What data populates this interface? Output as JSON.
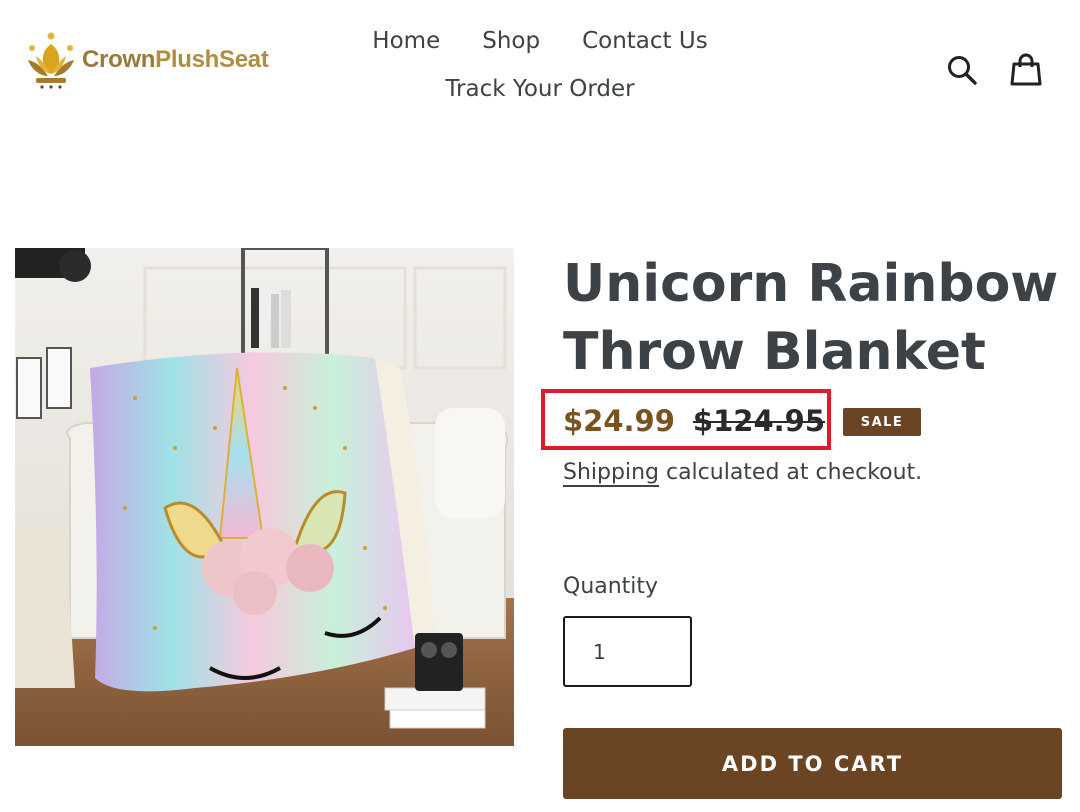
{
  "header": {
    "logo": {
      "text_part1": "Crown",
      "text_part2": "PlushSeat",
      "icon": "crown-icon"
    },
    "nav": [
      {
        "label": "Home"
      },
      {
        "label": "Shop"
      },
      {
        "label": "Contact Us"
      },
      {
        "label": "Track Your Order"
      }
    ],
    "icons": {
      "search": "search-icon",
      "cart": "cart-icon"
    }
  },
  "product": {
    "title": "Unicorn Rainbow Throw Blanket",
    "image_alt_icon": "unicorn-blanket-image",
    "sale_price": "$24.99",
    "regular_price": "$124.95",
    "sale_badge": "SALE",
    "shipping_link": "Shipping",
    "shipping_text": " calculated at checkout.",
    "quantity_label": "Quantity",
    "quantity_value": "1",
    "add_to_cart_label": "ADD TO CART"
  },
  "colors": {
    "brand_brown": "#6b4423",
    "sale_price": "#7a5220",
    "highlight_box": "#e11a2b",
    "text": "#3d4246"
  }
}
